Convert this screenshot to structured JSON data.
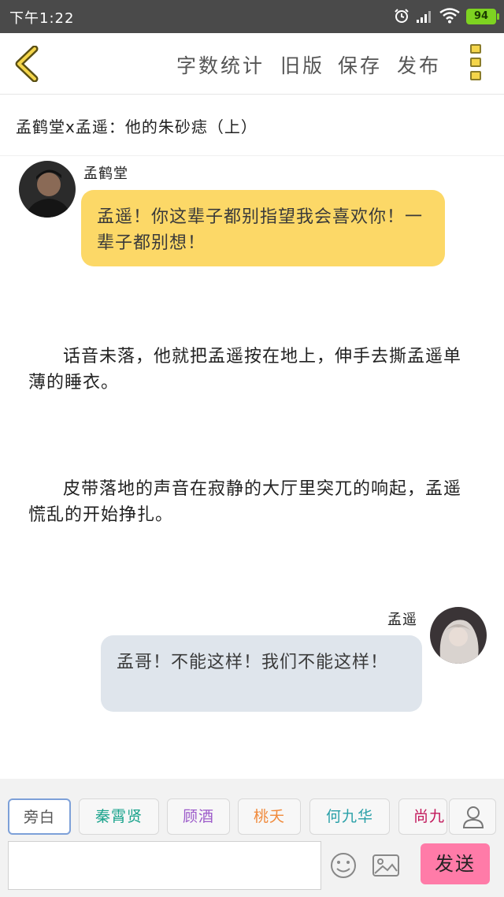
{
  "status_bar": {
    "time": "下午1:22",
    "battery": "94"
  },
  "toolbar": {
    "word_count": "字数统计",
    "old_version": "旧版",
    "save": "保存",
    "publish": "发布"
  },
  "story": {
    "title": "孟鹤堂x孟遥：他的朱砂痣（上）"
  },
  "messages": [
    {
      "speaker": "孟鹤堂",
      "text": "孟遥！你这辈子都别指望我会喜欢你！一辈子都别想！",
      "color": "#fcd867"
    },
    {
      "narration": "话音未落，他就把孟遥按在地上，伸手去撕孟遥单薄的睡衣。"
    },
    {
      "narration": "皮带落地的声音在寂静的大厅里突兀的响起，孟遥慌乱的开始挣扎。"
    },
    {
      "speaker": "孟遥",
      "text": "孟哥！不能这样！我们不能这样！",
      "color": "#dfe5ec"
    }
  ],
  "characters": [
    {
      "name": "旁白",
      "color": "#555555"
    },
    {
      "name": "秦霄贤",
      "color": "#1aa38c"
    },
    {
      "name": "顾酒",
      "color": "#9b59c9"
    },
    {
      "name": "桃夭",
      "color": "#f08a3c"
    },
    {
      "name": "何九华",
      "color": "#2aa0a8"
    },
    {
      "name": "尚九",
      "color": "#c2185b"
    }
  ],
  "composer": {
    "send": "发送",
    "input_value": ""
  },
  "colors": {
    "status_bar": "#4a4a4a",
    "send_button": "#ff7ba8",
    "selected_chip_border": "#7da0d8"
  }
}
